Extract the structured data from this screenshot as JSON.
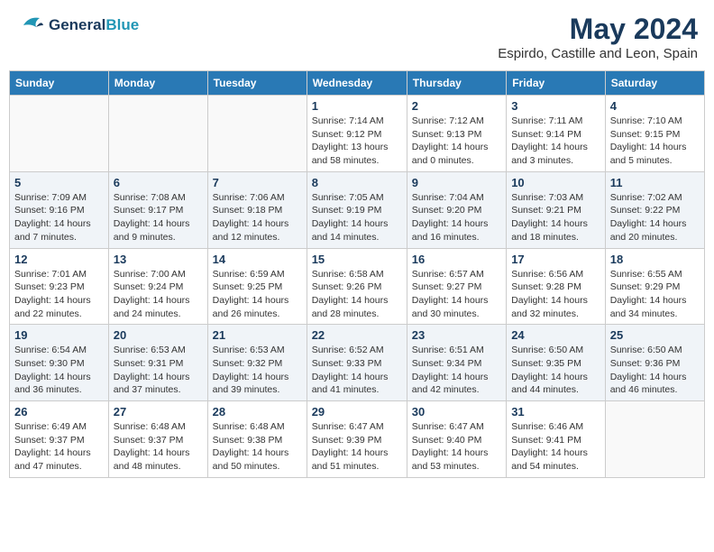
{
  "header": {
    "logo_general": "General",
    "logo_blue": "Blue",
    "month_title": "May 2024",
    "location": "Espirdo, Castille and Leon, Spain"
  },
  "days_of_week": [
    "Sunday",
    "Monday",
    "Tuesday",
    "Wednesday",
    "Thursday",
    "Friday",
    "Saturday"
  ],
  "weeks": [
    [
      {
        "day": "",
        "sunrise": "",
        "sunset": "",
        "daylight": ""
      },
      {
        "day": "",
        "sunrise": "",
        "sunset": "",
        "daylight": ""
      },
      {
        "day": "",
        "sunrise": "",
        "sunset": "",
        "daylight": ""
      },
      {
        "day": "1",
        "sunrise": "Sunrise: 7:14 AM",
        "sunset": "Sunset: 9:12 PM",
        "daylight": "Daylight: 13 hours and 58 minutes."
      },
      {
        "day": "2",
        "sunrise": "Sunrise: 7:12 AM",
        "sunset": "Sunset: 9:13 PM",
        "daylight": "Daylight: 14 hours and 0 minutes."
      },
      {
        "day": "3",
        "sunrise": "Sunrise: 7:11 AM",
        "sunset": "Sunset: 9:14 PM",
        "daylight": "Daylight: 14 hours and 3 minutes."
      },
      {
        "day": "4",
        "sunrise": "Sunrise: 7:10 AM",
        "sunset": "Sunset: 9:15 PM",
        "daylight": "Daylight: 14 hours and 5 minutes."
      }
    ],
    [
      {
        "day": "5",
        "sunrise": "Sunrise: 7:09 AM",
        "sunset": "Sunset: 9:16 PM",
        "daylight": "Daylight: 14 hours and 7 minutes."
      },
      {
        "day": "6",
        "sunrise": "Sunrise: 7:08 AM",
        "sunset": "Sunset: 9:17 PM",
        "daylight": "Daylight: 14 hours and 9 minutes."
      },
      {
        "day": "7",
        "sunrise": "Sunrise: 7:06 AM",
        "sunset": "Sunset: 9:18 PM",
        "daylight": "Daylight: 14 hours and 12 minutes."
      },
      {
        "day": "8",
        "sunrise": "Sunrise: 7:05 AM",
        "sunset": "Sunset: 9:19 PM",
        "daylight": "Daylight: 14 hours and 14 minutes."
      },
      {
        "day": "9",
        "sunrise": "Sunrise: 7:04 AM",
        "sunset": "Sunset: 9:20 PM",
        "daylight": "Daylight: 14 hours and 16 minutes."
      },
      {
        "day": "10",
        "sunrise": "Sunrise: 7:03 AM",
        "sunset": "Sunset: 9:21 PM",
        "daylight": "Daylight: 14 hours and 18 minutes."
      },
      {
        "day": "11",
        "sunrise": "Sunrise: 7:02 AM",
        "sunset": "Sunset: 9:22 PM",
        "daylight": "Daylight: 14 hours and 20 minutes."
      }
    ],
    [
      {
        "day": "12",
        "sunrise": "Sunrise: 7:01 AM",
        "sunset": "Sunset: 9:23 PM",
        "daylight": "Daylight: 14 hours and 22 minutes."
      },
      {
        "day": "13",
        "sunrise": "Sunrise: 7:00 AM",
        "sunset": "Sunset: 9:24 PM",
        "daylight": "Daylight: 14 hours and 24 minutes."
      },
      {
        "day": "14",
        "sunrise": "Sunrise: 6:59 AM",
        "sunset": "Sunset: 9:25 PM",
        "daylight": "Daylight: 14 hours and 26 minutes."
      },
      {
        "day": "15",
        "sunrise": "Sunrise: 6:58 AM",
        "sunset": "Sunset: 9:26 PM",
        "daylight": "Daylight: 14 hours and 28 minutes."
      },
      {
        "day": "16",
        "sunrise": "Sunrise: 6:57 AM",
        "sunset": "Sunset: 9:27 PM",
        "daylight": "Daylight: 14 hours and 30 minutes."
      },
      {
        "day": "17",
        "sunrise": "Sunrise: 6:56 AM",
        "sunset": "Sunset: 9:28 PM",
        "daylight": "Daylight: 14 hours and 32 minutes."
      },
      {
        "day": "18",
        "sunrise": "Sunrise: 6:55 AM",
        "sunset": "Sunset: 9:29 PM",
        "daylight": "Daylight: 14 hours and 34 minutes."
      }
    ],
    [
      {
        "day": "19",
        "sunrise": "Sunrise: 6:54 AM",
        "sunset": "Sunset: 9:30 PM",
        "daylight": "Daylight: 14 hours and 36 minutes."
      },
      {
        "day": "20",
        "sunrise": "Sunrise: 6:53 AM",
        "sunset": "Sunset: 9:31 PM",
        "daylight": "Daylight: 14 hours and 37 minutes."
      },
      {
        "day": "21",
        "sunrise": "Sunrise: 6:53 AM",
        "sunset": "Sunset: 9:32 PM",
        "daylight": "Daylight: 14 hours and 39 minutes."
      },
      {
        "day": "22",
        "sunrise": "Sunrise: 6:52 AM",
        "sunset": "Sunset: 9:33 PM",
        "daylight": "Daylight: 14 hours and 41 minutes."
      },
      {
        "day": "23",
        "sunrise": "Sunrise: 6:51 AM",
        "sunset": "Sunset: 9:34 PM",
        "daylight": "Daylight: 14 hours and 42 minutes."
      },
      {
        "day": "24",
        "sunrise": "Sunrise: 6:50 AM",
        "sunset": "Sunset: 9:35 PM",
        "daylight": "Daylight: 14 hours and 44 minutes."
      },
      {
        "day": "25",
        "sunrise": "Sunrise: 6:50 AM",
        "sunset": "Sunset: 9:36 PM",
        "daylight": "Daylight: 14 hours and 46 minutes."
      }
    ],
    [
      {
        "day": "26",
        "sunrise": "Sunrise: 6:49 AM",
        "sunset": "Sunset: 9:37 PM",
        "daylight": "Daylight: 14 hours and 47 minutes."
      },
      {
        "day": "27",
        "sunrise": "Sunrise: 6:48 AM",
        "sunset": "Sunset: 9:37 PM",
        "daylight": "Daylight: 14 hours and 48 minutes."
      },
      {
        "day": "28",
        "sunrise": "Sunrise: 6:48 AM",
        "sunset": "Sunset: 9:38 PM",
        "daylight": "Daylight: 14 hours and 50 minutes."
      },
      {
        "day": "29",
        "sunrise": "Sunrise: 6:47 AM",
        "sunset": "Sunset: 9:39 PM",
        "daylight": "Daylight: 14 hours and 51 minutes."
      },
      {
        "day": "30",
        "sunrise": "Sunrise: 6:47 AM",
        "sunset": "Sunset: 9:40 PM",
        "daylight": "Daylight: 14 hours and 53 minutes."
      },
      {
        "day": "31",
        "sunrise": "Sunrise: 6:46 AM",
        "sunset": "Sunset: 9:41 PM",
        "daylight": "Daylight: 14 hours and 54 minutes."
      },
      {
        "day": "",
        "sunrise": "",
        "sunset": "",
        "daylight": ""
      }
    ]
  ]
}
